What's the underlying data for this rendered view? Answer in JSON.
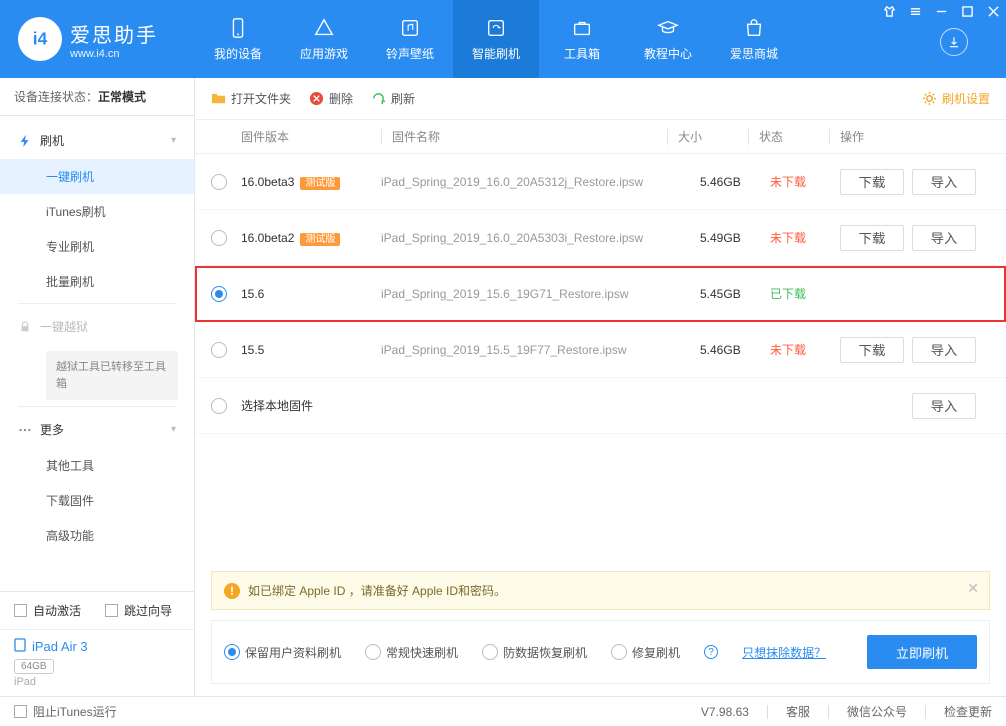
{
  "app": {
    "name": "爱思助手",
    "url": "www.i4.cn"
  },
  "nav": [
    {
      "label": "我的设备"
    },
    {
      "label": "应用游戏"
    },
    {
      "label": "铃声壁纸"
    },
    {
      "label": "智能刷机"
    },
    {
      "label": "工具箱"
    },
    {
      "label": "教程中心"
    },
    {
      "label": "爱思商城"
    }
  ],
  "conn": {
    "label": "设备连接状态：",
    "value": "正常模式"
  },
  "sidebar": {
    "flash_head": "刷机",
    "flash_items": [
      "一键刷机",
      "iTunes刷机",
      "专业刷机",
      "批量刷机"
    ],
    "jailbreak_head": "一键越狱",
    "jailbreak_notice": "越狱工具已转移至工具箱",
    "more_head": "更多",
    "more_items": [
      "其他工具",
      "下载固件",
      "高级功能"
    ]
  },
  "auto": {
    "activate": "自动激活",
    "skip": "跳过向导"
  },
  "device": {
    "name": "iPad Air 3",
    "capacity": "64GB",
    "type": "iPad"
  },
  "toolbar": {
    "open": "打开文件夹",
    "del": "删除",
    "refresh": "刷新",
    "settings": "刷机设置"
  },
  "thead": {
    "ver": "固件版本",
    "name": "固件名称",
    "size": "大小",
    "status": "状态",
    "ops": "操作"
  },
  "rows": [
    {
      "ver": "16.0beta3",
      "beta": "测试版",
      "fname": "iPad_Spring_2019_16.0_20A5312j_Restore.ipsw",
      "size": "5.46GB",
      "status": "未下载",
      "downloaded": false,
      "selected": false,
      "showOps": true
    },
    {
      "ver": "16.0beta2",
      "beta": "测试版",
      "fname": "iPad_Spring_2019_16.0_20A5303i_Restore.ipsw",
      "size": "5.49GB",
      "status": "未下载",
      "downloaded": false,
      "selected": false,
      "showOps": true
    },
    {
      "ver": "15.6",
      "beta": "",
      "fname": "iPad_Spring_2019_15.6_19G71_Restore.ipsw",
      "size": "5.45GB",
      "status": "已下载",
      "downloaded": true,
      "selected": true,
      "showOps": false
    },
    {
      "ver": "15.5",
      "beta": "",
      "fname": "iPad_Spring_2019_15.5_19F77_Restore.ipsw",
      "size": "5.46GB",
      "status": "未下载",
      "downloaded": false,
      "selected": false,
      "showOps": true
    }
  ],
  "local_row": "选择本地固件",
  "ops": {
    "dl": "下载",
    "import": "导入"
  },
  "notice": "如已绑定 Apple ID ，请准备好 Apple ID和密码。",
  "flash_opts": {
    "keep": "保留用户资料刷机",
    "fast": "常规快速刷机",
    "anti": "防数据恢复刷机",
    "repair": "修复刷机",
    "erase_link": "只想抹除数据？",
    "button": "立即刷机"
  },
  "statusbar": {
    "block_itunes": "阻止iTunes运行",
    "version": "V7.98.63",
    "cs": "客服",
    "wechat": "微信公众号",
    "update": "检查更新"
  }
}
